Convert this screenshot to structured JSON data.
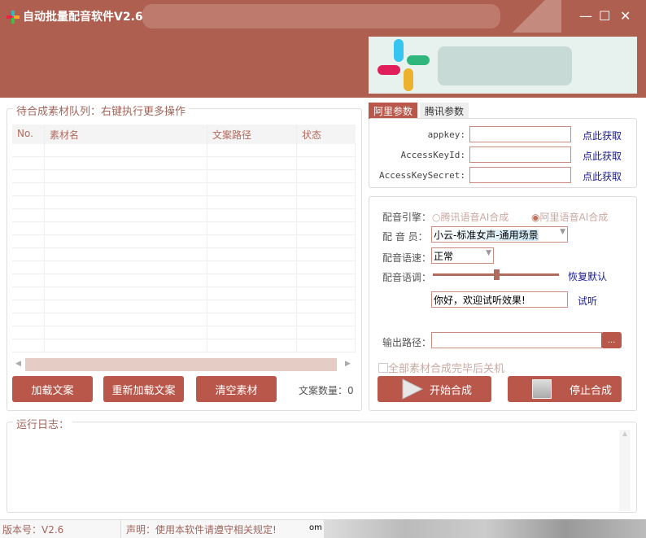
{
  "window": {
    "title": "自动批量配音软件V2.6",
    "minimize": "—",
    "maximize": "☐",
    "close": "✕"
  },
  "queue": {
    "label": "待合成素材队列：右键执行更多操作",
    "columns": [
      "No.",
      "素材名",
      "文案路径",
      "状态"
    ],
    "count_label": "文案数量：",
    "count": "0",
    "buttons": {
      "load": "加载文案",
      "reload": "重新加载文案",
      "clear": "清空素材"
    }
  },
  "tabs": [
    "阿里参数",
    "腾讯参数"
  ],
  "keys": [
    {
      "label": "appkey:",
      "link": "点此获取",
      "value": ""
    },
    {
      "label": "AccessKeyId:",
      "link": "点此获取",
      "value": ""
    },
    {
      "label": "AccessKeySecret:",
      "link": "点此获取",
      "value": ""
    }
  ],
  "settings": {
    "engine_label": "配音引擎：",
    "engine_options": [
      "腾讯语音AI合成",
      "阿里语音AI合成"
    ],
    "engine_selected": "阿里语音AI合成",
    "voice_label": "配 音 员：",
    "voice": "小云-标准女声-通用场景",
    "speed_label": "配音语速：",
    "speed": "正常",
    "pitch_label": "配音语调：",
    "pitch_value": 0.5,
    "reset": "恢复默认",
    "preview_text": "你好，欢迎试听效果!",
    "listen": "试听",
    "output_label": "输出路径：",
    "output_value": "",
    "browse": "...",
    "shutdown": "全部素材合成完毕后关机",
    "shutdown_checked": false,
    "start": "开始合成",
    "stop": "停止合成"
  },
  "log": {
    "label": "运行日志："
  },
  "status": {
    "version": "版本号：V2.6",
    "notice": "声明：使用本软件请遵守相关规定!",
    "extra": "om ."
  },
  "colors": {
    "accent": "#b9574a",
    "header": "#ae5f50",
    "link": "#1a1a8e"
  }
}
